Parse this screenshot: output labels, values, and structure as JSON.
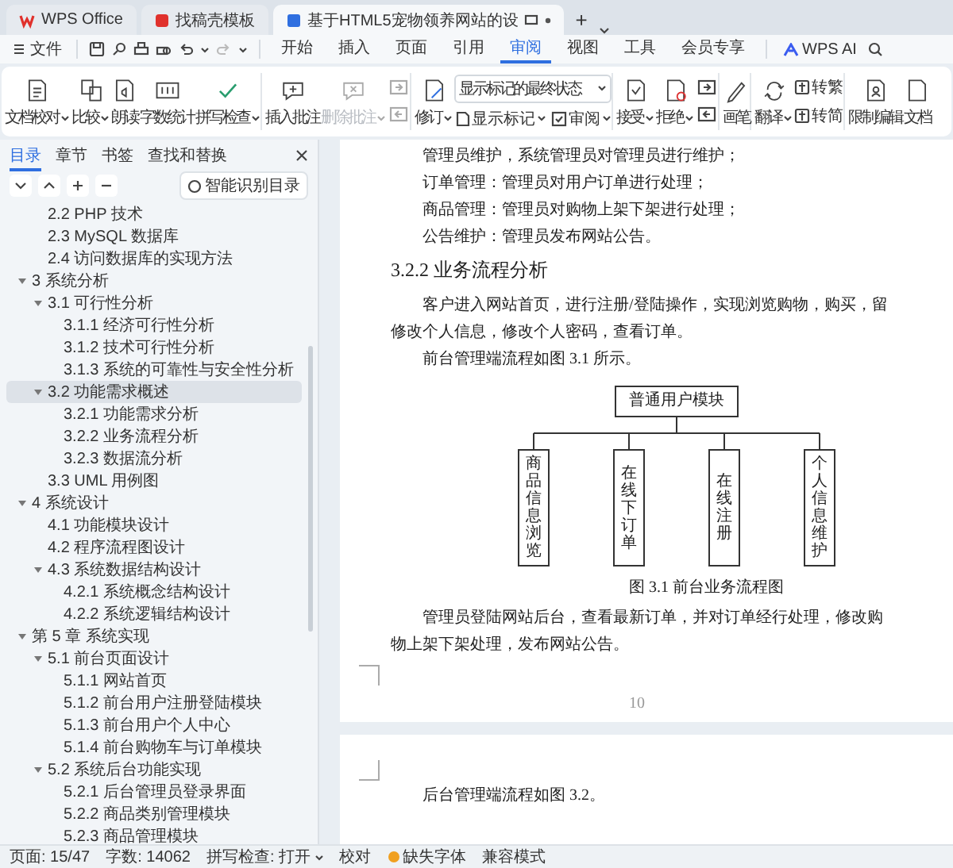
{
  "title_bar": {
    "tabs": [
      {
        "label": "WPS Office",
        "selected": false
      },
      {
        "label": "找稿壳模板",
        "selected": false
      },
      {
        "label": "基于HTML5宠物领养网站的设",
        "selected": true
      }
    ],
    "new_tab": "+"
  },
  "menu_bar": {
    "file": "文件",
    "tabs": [
      {
        "label": "开始",
        "selected": false
      },
      {
        "label": "插入",
        "selected": false
      },
      {
        "label": "页面",
        "selected": false
      },
      {
        "label": "引用",
        "selected": false
      },
      {
        "label": "审阅",
        "selected": true
      },
      {
        "label": "视图",
        "selected": false
      },
      {
        "label": "工具",
        "selected": false
      },
      {
        "label": "会员专享",
        "selected": false
      }
    ],
    "ai": "WPS AI"
  },
  "ribbon": {
    "groups": [
      {
        "items": [
          {
            "kind": "large",
            "label": "文档校对",
            "dropdown": true,
            "disabled": false
          },
          {
            "kind": "large",
            "label": "比较",
            "dropdown": true,
            "disabled": false
          },
          {
            "kind": "large",
            "label": "朗读",
            "dropdown": false,
            "disabled": false
          },
          {
            "kind": "large",
            "label": "字数统计",
            "dropdown": false,
            "disabled": false
          },
          {
            "kind": "large",
            "label": "拼写检查",
            "dropdown": true,
            "disabled": false
          }
        ]
      },
      {
        "items": [
          {
            "kind": "large",
            "label": "插入批注",
            "dropdown": false,
            "disabled": false
          },
          {
            "kind": "large",
            "label": "删除批注",
            "dropdown": true,
            "disabled": true
          },
          {
            "kind": "pair",
            "disabled": true
          }
        ]
      },
      {
        "items": [
          {
            "kind": "large",
            "label": "修订",
            "dropdown": true,
            "disabled": false
          },
          {
            "kind": "markup",
            "select": "显示标记的最终状态",
            "buttons": [
              "显示标记",
              "审阅"
            ],
            "disabled": false
          }
        ]
      },
      {
        "items": [
          {
            "kind": "large",
            "label": "接受",
            "dropdown": true,
            "disabled": false
          },
          {
            "kind": "large",
            "label": "拒绝",
            "dropdown": true,
            "disabled": false
          },
          {
            "kind": "pair",
            "disabled": false
          }
        ]
      },
      {
        "items": [
          {
            "kind": "large",
            "label": "画笔",
            "dropdown": false,
            "disabled": false
          }
        ]
      },
      {
        "items": [
          {
            "kind": "large",
            "label": "翻译",
            "dropdown": true,
            "disabled": false
          },
          {
            "kind": "convert",
            "buttons": [
              "转繁",
              "转简"
            ],
            "disabled": false
          }
        ]
      },
      {
        "items": [
          {
            "kind": "large",
            "label": "限制编辑",
            "dropdown": false,
            "disabled": false
          },
          {
            "kind": "large",
            "label": "文档",
            "dropdown": false,
            "disabled": false
          }
        ]
      }
    ]
  },
  "nav_panel": {
    "tabs": [
      {
        "label": "目录",
        "selected": true
      },
      {
        "label": "章节",
        "selected": false
      },
      {
        "label": "书签",
        "selected": false
      },
      {
        "label": "查找和替换",
        "selected": false
      }
    ],
    "smart_button": "智能识别目录",
    "outline": [
      {
        "children": [
          {
            "label": "2.2 PHP 技术",
            "selected": false
          },
          {
            "label": "2.3 MySQL 数据库",
            "selected": false
          },
          {
            "label": "2.4  访问数据库的实现方法",
            "selected": false
          }
        ]
      },
      {
        "label": "3  系统分析",
        "selected": false,
        "expanded": true,
        "children": [
          {
            "label": "3.1  可行性分析",
            "selected": false,
            "expanded": true,
            "children": [
              {
                "label": "3.1.1  经济可行性分析",
                "selected": false
              },
              {
                "label": "3.1.2  技术可行性分析",
                "selected": false
              },
              {
                "label": "3.1.3  系统的可靠性与安全性分析",
                "selected": false
              }
            ]
          },
          {
            "label": "3.2  功能需求概述",
            "selected": true,
            "expanded": true,
            "children": [
              {
                "label": "3.2.1 功能需求分析",
                "selected": false
              },
              {
                "label": "3.2.2  业务流程分析",
                "selected": false
              },
              {
                "label": "3.2.3  数据流分析",
                "selected": false
              }
            ]
          },
          {
            "label": "3.3 UML 用例图",
            "selected": false
          }
        ]
      },
      {
        "label": "4  系统设计",
        "selected": false,
        "expanded": true,
        "children": [
          {
            "label": "4.1 功能模块设计",
            "selected": false
          },
          {
            "label": "4.2  程序流程图设计",
            "selected": false
          },
          {
            "label": "4.3  系统数据结构设计",
            "selected": false,
            "expanded": true,
            "children": [
              {
                "label": "4.2.1  系统概念结构设计",
                "selected": false
              },
              {
                "label": "4.2.2  系统逻辑结构设计",
                "selected": false
              }
            ]
          }
        ]
      },
      {
        "label": "第 5 章  系统实现",
        "selected": false,
        "expanded": true,
        "children": [
          {
            "label": "5.1 前台页面设计",
            "selected": false,
            "expanded": true,
            "children": [
              {
                "label": "5.1.1 网站首页",
                "selected": false
              },
              {
                "label": "5.1.2 前台用户注册登陆模块",
                "selected": false
              },
              {
                "label": "5.1.3 前台用户个人中心",
                "selected": false
              },
              {
                "label": "5.1.4 前台购物车与订单模块",
                "selected": false
              }
            ]
          },
          {
            "label": "5.2 系统后台功能实现",
            "selected": false,
            "expanded": true,
            "children": [
              {
                "label": "5.2.1 后台管理员登录界面",
                "selected": false
              },
              {
                "label": "5.2.2 商品类别管理模块",
                "selected": false
              },
              {
                "label": "5.2.3 商品管理模块",
                "selected": false
              }
            ]
          }
        ]
      }
    ]
  },
  "document": {
    "pages": [
      {
        "blocks": [
          {
            "kind": "paragraph",
            "lines": [
              "管理员维护，系统管理员对管理员进行维护；"
            ]
          },
          {
            "kind": "paragraph",
            "lines": [
              "订单管理：管理员对用户订单进行处理；"
            ]
          },
          {
            "kind": "paragraph",
            "lines": [
              "商品管理：管理员对购物上架下架进行处理；"
            ]
          },
          {
            "kind": "paragraph",
            "lines": [
              "公告维护：管理员发布网站公告。"
            ]
          },
          {
            "kind": "heading",
            "text": "3.2.2  业务流程分析"
          },
          {
            "kind": "paragraph",
            "lines": [
              "客户进入网站首页，进行注册/登陆操作，实现浏览购物，购买，留",
              "修改个人信息，修改个人密码，查看订单。"
            ]
          },
          {
            "kind": "paragraph",
            "lines": [
              "前台管理端流程如图 3.1 所示。"
            ]
          },
          {
            "kind": "diagram",
            "root": "普通用户模块",
            "nodes": [
              "商品信息浏览",
              "在线下订单",
              "在线注册",
              "个人信息维护"
            ]
          },
          {
            "kind": "caption",
            "text": "图 3.1  前台业务流程图"
          },
          {
            "kind": "paragraph",
            "lines": [
              "管理员登陆网站后台，查看最新订单，并对订单经行处理，修改购",
              "物上架下架处理，发布网站公告。"
            ]
          }
        ],
        "page_number": "10"
      },
      {
        "blocks": [
          {
            "kind": "paragraph",
            "lines": [
              "后台管理端流程如图 3.2。"
            ]
          }
        ]
      }
    ]
  },
  "status_bar": {
    "page": "页面: 15/47",
    "words": "字数: 14062",
    "spell_check": "拼写检查: 打开",
    "proofread": "校对",
    "missing_font": "缺失字体",
    "compat": "兼容模式"
  }
}
